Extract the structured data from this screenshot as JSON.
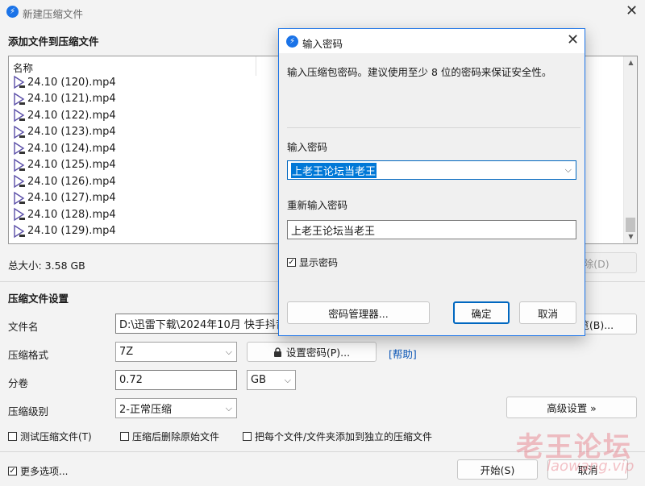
{
  "window": {
    "title": "新建压缩文件",
    "app_icon": "thunder-logo-icon"
  },
  "add_files": {
    "heading": "添加文件到压缩文件",
    "column_name": "名称",
    "files": [
      "24.10 (120).mp4",
      "24.10 (121).mp4",
      "24.10 (122).mp4",
      "24.10 (123).mp4",
      "24.10 (124).mp4",
      "24.10 (125).mp4",
      "24.10 (126).mp4",
      "24.10 (127).mp4",
      "24.10 (128).mp4",
      "24.10 (129).mp4"
    ],
    "total_size": "总大小: 3.58 GB",
    "delete_button": "删除(D)"
  },
  "settings": {
    "heading": "压缩文件设置",
    "filename_label": "文件名",
    "filename_value": "D:\\迅雷下载\\2024年10月 快手抖音",
    "browse_button": "浏览(B)...",
    "format_label": "压缩格式",
    "format_value": "7Z",
    "set_password_button": "设置密码(P)...",
    "help_link": "[帮助]",
    "volume_label": "分卷",
    "volume_value": "0.72",
    "volume_unit": "GB",
    "level_label": "压缩级别",
    "level_value": "2-正常压缩",
    "advanced_button": "高级设置 »",
    "test_archive": "测试压缩文件(T)",
    "delete_after": "压缩后删除原始文件",
    "each_separate": "把每个文件/文件夹添加到独立的压缩文件",
    "more_options": "更多选项...",
    "start_button": "开始(S)",
    "cancel_button": "取消"
  },
  "password_dialog": {
    "title": "输入密码",
    "hint": "输入压缩包密码。建议使用至少 8 位的密码来保证安全性。",
    "enter_label": "输入密码",
    "password_value": "上老王论坛当老王",
    "reenter_label": "重新输入密码",
    "reenter_value": "上老王论坛当老王",
    "show_password": "显示密码",
    "manager_button": "密码管理器...",
    "ok_button": "确定",
    "cancel_button": "取消"
  },
  "watermark": {
    "text": "老王论坛",
    "url": "laowang.vip"
  },
  "colors": {
    "accent": "#0067c0",
    "selection": "#0078d7",
    "link": "#0b57b8"
  }
}
